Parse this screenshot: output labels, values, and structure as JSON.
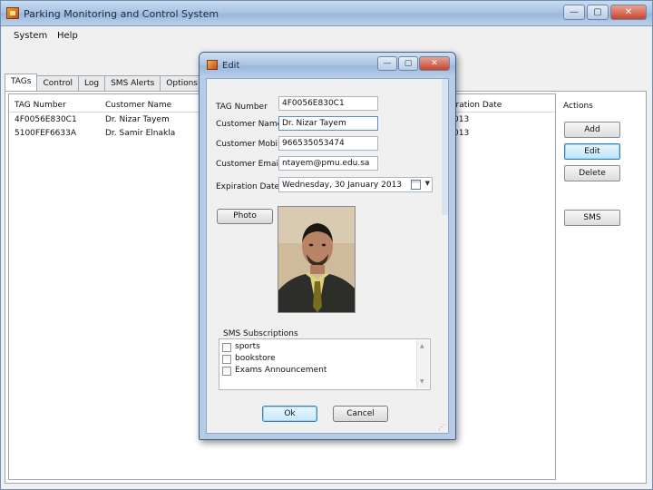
{
  "window": {
    "title": "Parking Monitoring and Control System",
    "buttons": {
      "minimize": "—",
      "maximize": "▢",
      "close": "✕"
    }
  },
  "menu": [
    "System",
    "Help"
  ],
  "tabs": [
    "TAGs",
    "Control",
    "Log",
    "SMS Alerts",
    "Options"
  ],
  "active_tab": "TAGs",
  "grid": {
    "columns": [
      "TAG Number",
      "Customer Name",
      "iration Date"
    ],
    "rows": [
      {
        "tag": "4F0056E830C1",
        "name": "Dr. Nizar Tayem",
        "date": "013"
      },
      {
        "tag": "5100FEF6633A",
        "name": "Dr. Samir Elnakla",
        "date": "013"
      }
    ]
  },
  "actions": {
    "label": "Actions",
    "buttons": [
      "Add",
      "Edit",
      "Delete",
      "SMS"
    ]
  },
  "dialog": {
    "title": "Edit",
    "buttons": {
      "minimize": "—",
      "maximize": "▢",
      "close": "✕"
    },
    "fields": {
      "tag_label": "TAG Number",
      "tag_value": "4F0056E830C1",
      "name_label": "Customer Name",
      "name_value": "Dr. Nizar Tayem",
      "mobile_label": "Customer Mobile",
      "mobile_value": "966535053474",
      "email_label": "Customer Email",
      "email_value": "ntayem@pmu.edu.sa",
      "date_label": "Expiration Date",
      "date_value": "Wednesday,  30   January   2013"
    },
    "photo_button": "Photo",
    "sms": {
      "title": "SMS Subscriptions",
      "items": [
        {
          "label": "sports",
          "checked": false
        },
        {
          "label": "bookstore",
          "checked": false
        },
        {
          "label": "Exams Announcement",
          "checked": false
        }
      ]
    },
    "ok": "Ok",
    "cancel": "Cancel"
  },
  "colors": {
    "titlebar": "#a9c4e3",
    "dialog_frame": "#b6cbe6",
    "focus_border": "#3c7fb1",
    "close_button": "#c8452f"
  }
}
